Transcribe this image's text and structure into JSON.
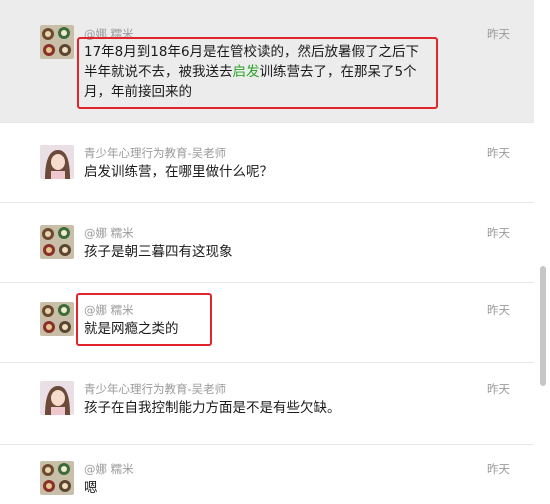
{
  "comments": [
    {
      "name": "@娜 糯米",
      "time": "昨天",
      "text_lines": [
        "17年8月到18年6月是在管校读的，然后放暑假了之后下",
        "半年就说不去，被我送去",
        "月，年前接回来的"
      ],
      "line2_green": "启发",
      "line2_tail": "训练营去了，在那呆了5个",
      "avatar": "food-avatar-icon"
    },
    {
      "name": "青少年心理行为教育-吴老师",
      "time": "昨天",
      "text": "启发训练营，在哪里做什么呢？",
      "avatar": "girl-avatar-icon"
    },
    {
      "name": "@娜 糯米",
      "time": "昨天",
      "text": "孩子是朝三暮四有这现象",
      "avatar": "food-avatar-icon"
    },
    {
      "name": "@娜 糯米",
      "time": "昨天",
      "text": "就是网瘾之类的",
      "avatar": "food-avatar-icon"
    },
    {
      "name": "青少年心理行为教育-吴老师",
      "time": "昨天",
      "text": "孩子在自我控制能力方面是不是有些欠缺。",
      "avatar": "girl-avatar-icon"
    },
    {
      "name": "@娜 糯米",
      "time": "昨天",
      "text": "嗯",
      "avatar": "food-avatar-icon"
    }
  ],
  "colors": {
    "highlight_bg": "#ececec",
    "annotation_red": "#e0262b",
    "keyword_green": "#2aa52a"
  }
}
